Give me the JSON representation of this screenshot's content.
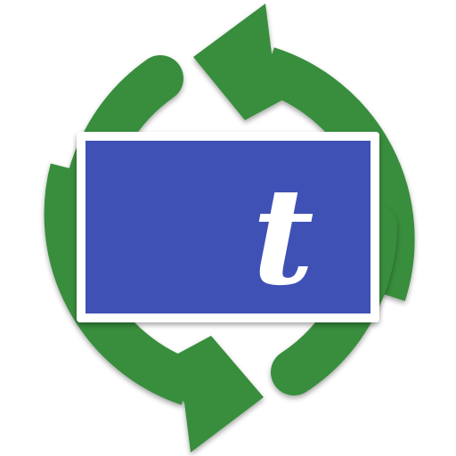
{
  "app_icon": {
    "icon_name": "sync-arrows-icon",
    "glyph": "t",
    "colors": {
      "arrow_green": "#388e3c",
      "panel_blue": "#3f51b5",
      "panel_border": "#ffffff",
      "glyph_white": "#ffffff",
      "background": "#ffffff"
    }
  }
}
